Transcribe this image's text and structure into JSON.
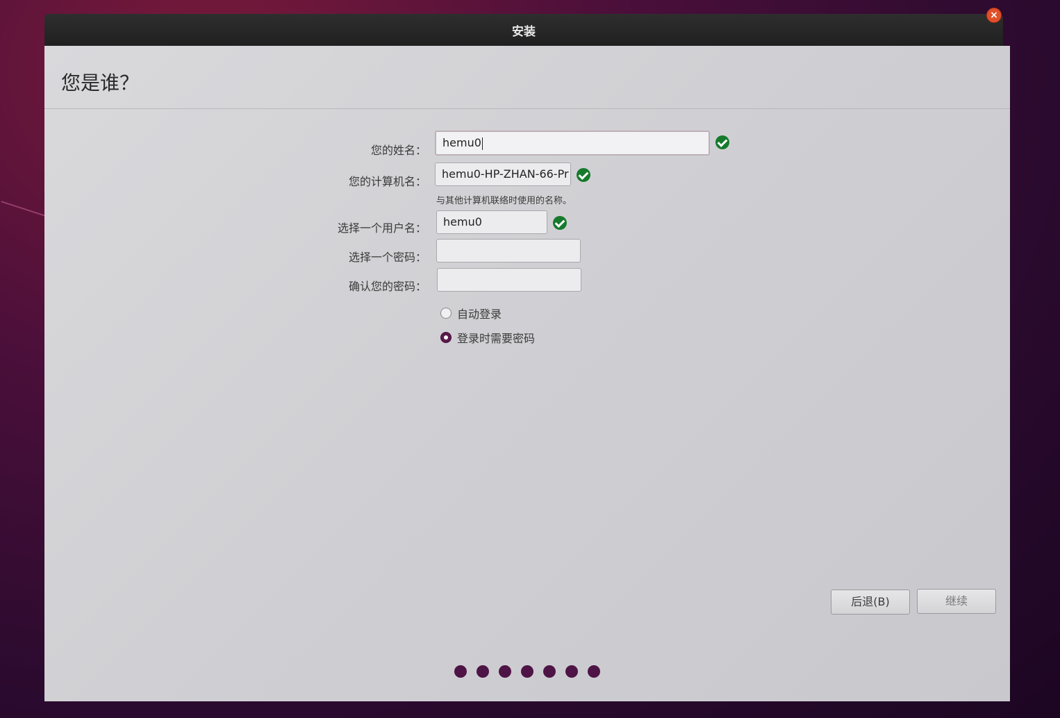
{
  "window": {
    "title": "安装",
    "close_symbol": "×"
  },
  "page": {
    "title": "您是谁？"
  },
  "form": {
    "name_label": "您的姓名：",
    "name_value": "hemu0",
    "computer_label": "您的计算机名：",
    "computer_value": "hemu0-HP-ZHAN-66-Pr",
    "computer_hint": "与其他计算机联络时使用的名称。",
    "username_label": "选择一个用户名：",
    "username_value": "hemu0",
    "password_label": "选择一个密码：",
    "password_value": "",
    "confirm_label": "确认您的密码：",
    "confirm_value": "",
    "autologin_label": "自动登录",
    "require_password_label": "登录时需要密码",
    "selected_login_option": "require_password"
  },
  "buttons": {
    "back_label": "后退(B)",
    "continue_label": "继续"
  },
  "progress": {
    "total_steps": 7
  },
  "colors": {
    "valid_check": "#167a2d",
    "accent": "#4e1446",
    "titlebar": "#202020"
  },
  "icons": {
    "valid": "check-circle-icon",
    "close": "close-icon"
  }
}
